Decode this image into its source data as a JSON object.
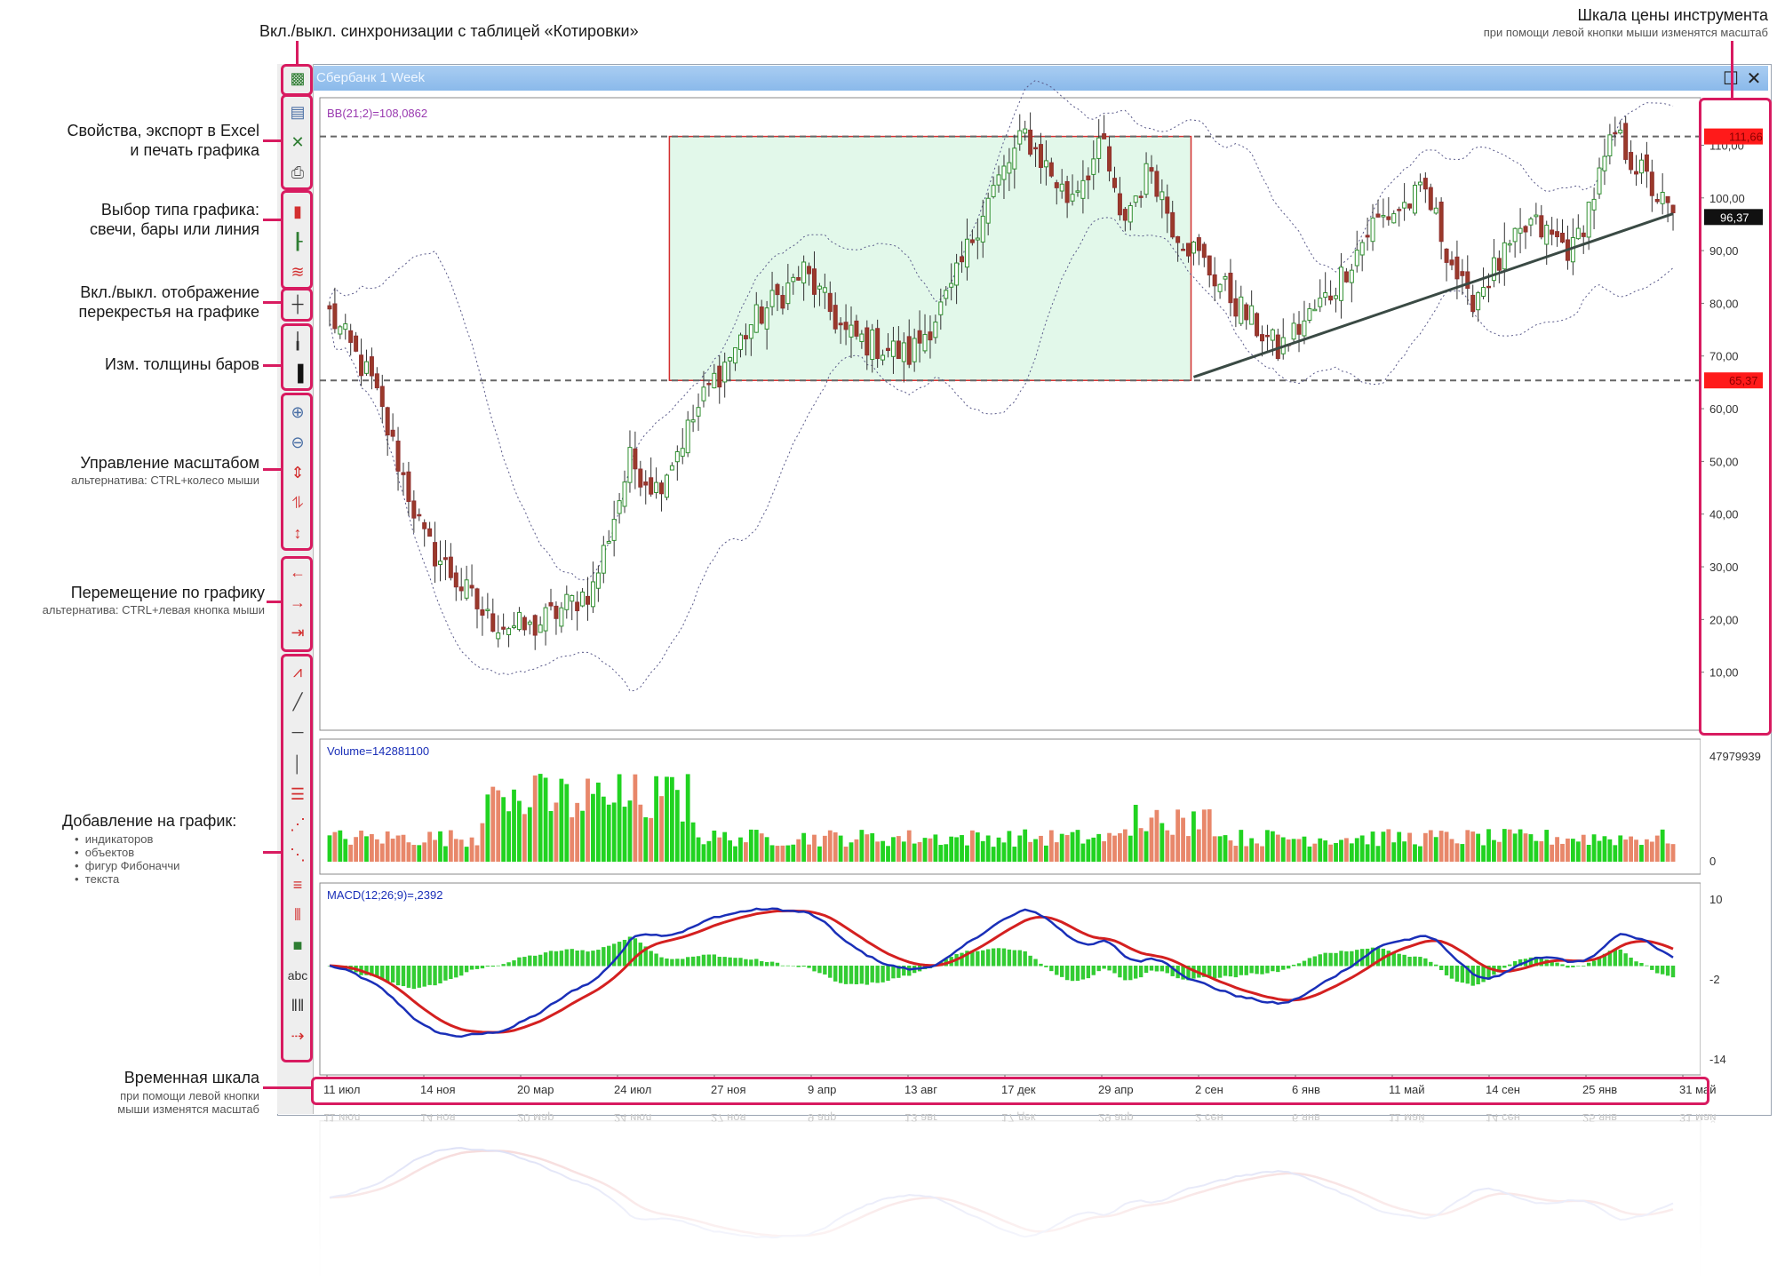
{
  "window": {
    "title": "Сбербанк 1 Week"
  },
  "annotations": {
    "sync": "Вкл./выкл. синхронизации с таблицей «Котировки»",
    "props_1": "Свойства, экспорт в Excel",
    "props_2": "и печать графика",
    "type_1": "Выбор типа графика:",
    "type_2": "свечи, бары или линия",
    "cross_1": "Вкл./выкл. отображение",
    "cross_2": "перекрестья на графике",
    "thick": "Изм. толщины баров",
    "zoom": "Управление масштабом",
    "zoom_sub": "альтернатива: CTRL+колесо мыши",
    "move": "Перемещение по графику",
    "move_sub": "альтернатива: CTRL+левая кнопка  мыши",
    "add": "Добавление на график:",
    "add_items": [
      "индикаторов",
      "объектов",
      "фигур Фибоначчи",
      "текста"
    ],
    "time": "Временная шкала",
    "time_sub_1": "при помощи левой кнопки",
    "time_sub_2": "мыши изменятся масштаб",
    "price": "Шкала цены инструмента",
    "price_sub": "при помощи левой кнопки мыши изменятся масштаб"
  },
  "toolbar_icons": [
    {
      "name": "sync-quotes-icon",
      "glyph": "▩",
      "color": "#2e7d32"
    },
    {
      "name": "chart-properties-icon",
      "glyph": "▤",
      "color": "#4a6fa5"
    },
    {
      "name": "excel-export-icon",
      "glyph": "✕",
      "color": "#2e7d32"
    },
    {
      "name": "print-icon",
      "glyph": "⎙",
      "color": "#555555"
    },
    {
      "name": "candles-icon",
      "glyph": "▮",
      "color": "#d32f2f"
    },
    {
      "name": "bars-icon",
      "glyph": "┠",
      "color": "#2e7d32"
    },
    {
      "name": "line-icon",
      "glyph": "≋",
      "color": "#d32f2f"
    },
    {
      "name": "crosshair-icon",
      "glyph": "┼",
      "color": "#333333"
    },
    {
      "name": "thin-bar-icon",
      "glyph": "╽",
      "color": "#333333"
    },
    {
      "name": "thick-bar-icon",
      "glyph": "▐",
      "color": "#111111"
    },
    {
      "name": "zoom-in-icon",
      "glyph": "⊕",
      "color": "#4a6fa5"
    },
    {
      "name": "zoom-out-icon",
      "glyph": "⊖",
      "color": "#4a6fa5"
    },
    {
      "name": "stretch-vertical-icon",
      "glyph": "⇕",
      "color": "#d32f2f"
    },
    {
      "name": "compress-vertical-icon",
      "glyph": "⥮",
      "color": "#d32f2f"
    },
    {
      "name": "fit-vertical-icon",
      "glyph": "↕",
      "color": "#d32f2f"
    },
    {
      "name": "scroll-left-icon",
      "glyph": "←",
      "color": "#d32f2f"
    },
    {
      "name": "scroll-right-icon",
      "glyph": "→",
      "color": "#d32f2f"
    },
    {
      "name": "scroll-end-icon",
      "glyph": "⇥",
      "color": "#d32f2f"
    },
    {
      "name": "indicators-icon",
      "glyph": "⩘",
      "color": "#d32f2f"
    },
    {
      "name": "trendline-icon",
      "glyph": "╱",
      "color": "#444444"
    },
    {
      "name": "horizontal-line-icon",
      "glyph": "─",
      "color": "#444444"
    },
    {
      "name": "vertical-line-icon",
      "glyph": "│",
      "color": "#444444"
    },
    {
      "name": "fibo-levels-icon",
      "glyph": "☰",
      "color": "#d32f2f"
    },
    {
      "name": "fibo-fan-icon",
      "glyph": "⋰",
      "color": "#d32f2f"
    },
    {
      "name": "fibo-arcs-icon",
      "glyph": "⋱",
      "color": "#d32f2f"
    },
    {
      "name": "fibo-channel-icon",
      "glyph": "≡",
      "color": "#d32f2f"
    },
    {
      "name": "fibo-timezones-icon",
      "glyph": "⦀",
      "color": "#d32f2f"
    },
    {
      "name": "rectangle-icon",
      "glyph": "■",
      "color": "#2e7d32"
    },
    {
      "name": "text-icon",
      "glyph": "abc",
      "color": "#333333"
    },
    {
      "name": "period-lines-icon",
      "glyph": "‖‖",
      "color": "#333333"
    },
    {
      "name": "delete-objects-icon",
      "glyph": "⇢",
      "color": "#d32f2f"
    }
  ],
  "colors": {
    "up": "#21d321",
    "down": "#e8876a",
    "macd": "#1a2fb8",
    "signal": "#d42020",
    "accent": "#d81b60",
    "box_fill": "#e2f8ea",
    "box_border": "#d32f2f"
  },
  "chart_data": [
    {
      "type": "candlestick",
      "name": "price",
      "indicator_label": "BB(21;2)=108,0862",
      "y_ticks": [
        "110,00",
        "100,00",
        "90,00",
        "80,00",
        "70,00",
        "60,00",
        "50,00",
        "40,00",
        "30,00",
        "20,00",
        "10,00"
      ],
      "ylim": [
        0,
        118
      ],
      "levels": [
        {
          "value": 111.66,
          "label": "111,66"
        },
        {
          "value": 65.37,
          "label": "65,37"
        }
      ],
      "last_price": {
        "value": 96.37,
        "label": "96,37"
      },
      "waypoints_idx": [
        0,
        8,
        18,
        30,
        38,
        50,
        57,
        62,
        68,
        72,
        80,
        90,
        98,
        104,
        110,
        118,
        124,
        132,
        140,
        147,
        150,
        156,
        160,
        172,
        180,
        190,
        198,
        208,
        216,
        228,
        236,
        244,
        255
      ],
      "waypoints_price": [
        78,
        65,
        35,
        20,
        18,
        26,
        50,
        45,
        56,
        64,
        76,
        86,
        74,
        72,
        70,
        82,
        98,
        112,
        100,
        110,
        95,
        106,
        95,
        80,
        71,
        82,
        95,
        101,
        80,
        95,
        90,
        112,
        96
      ],
      "box": {
        "x_range": [
          65,
          163
        ],
        "y_range": [
          65.37,
          111.66
        ]
      },
      "trendline": {
        "from_index": 164,
        "from_value": 66,
        "to_index": 255,
        "to_value": 97
      }
    },
    {
      "type": "bar",
      "name": "volume",
      "indicator_label": "Volume=142881100",
      "y_ticks": [
        "47979939",
        "0"
      ]
    },
    {
      "type": "line",
      "name": "macd",
      "indicator_label": "MACD(12;26;9)=,2392",
      "y_ticks": [
        "10",
        "-2",
        "-14"
      ],
      "ylim": [
        -14,
        10
      ]
    }
  ],
  "x_ticks": [
    "11 июл",
    "14 ноя",
    "20 мар",
    "24 июл",
    "27 ноя",
    "9 апр",
    "13 авг",
    "17 дек",
    "29 апр",
    "2 сен",
    "6 янв",
    "11 май",
    "14 сен",
    "25 янв",
    "31 май"
  ]
}
